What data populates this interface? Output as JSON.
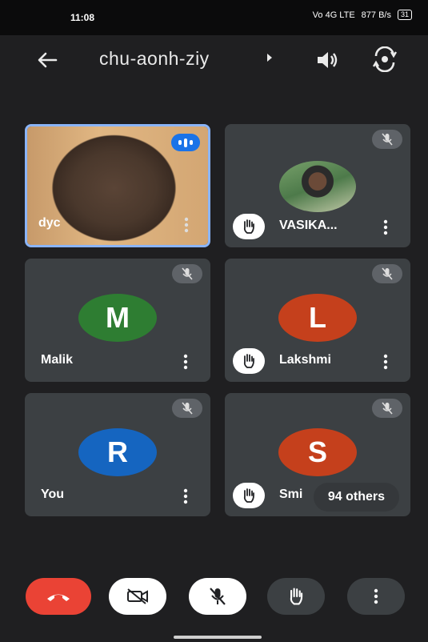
{
  "status_bar": {
    "time": "11:08",
    "network": "Vo 4G LTE",
    "speed": "877 B/s",
    "battery": "31"
  },
  "header": {
    "meeting_code": "chu-aonh-ziy"
  },
  "tiles": [
    {
      "name": "dyc",
      "type": "video",
      "speaking": true
    },
    {
      "name": "VASIKA...",
      "type": "photo",
      "muted": true,
      "hand_raised": true
    },
    {
      "name": "Malik",
      "initial": "M",
      "color": "#2e7d32",
      "muted": true
    },
    {
      "name": "Lakshmi",
      "initial": "L",
      "color": "#c5401c",
      "muted": true,
      "hand_raised": true
    },
    {
      "name": "You",
      "initial": "R",
      "color": "#1565c0",
      "muted": true
    },
    {
      "name": "Smi",
      "initial": "S",
      "color": "#c5401c",
      "muted": true,
      "hand_raised": true
    }
  ],
  "others_pill": "94 others",
  "controls": {
    "end_call_color": "#ea4335",
    "light_button_color": "#ffffff",
    "dark_button_color": "#3c4043"
  }
}
